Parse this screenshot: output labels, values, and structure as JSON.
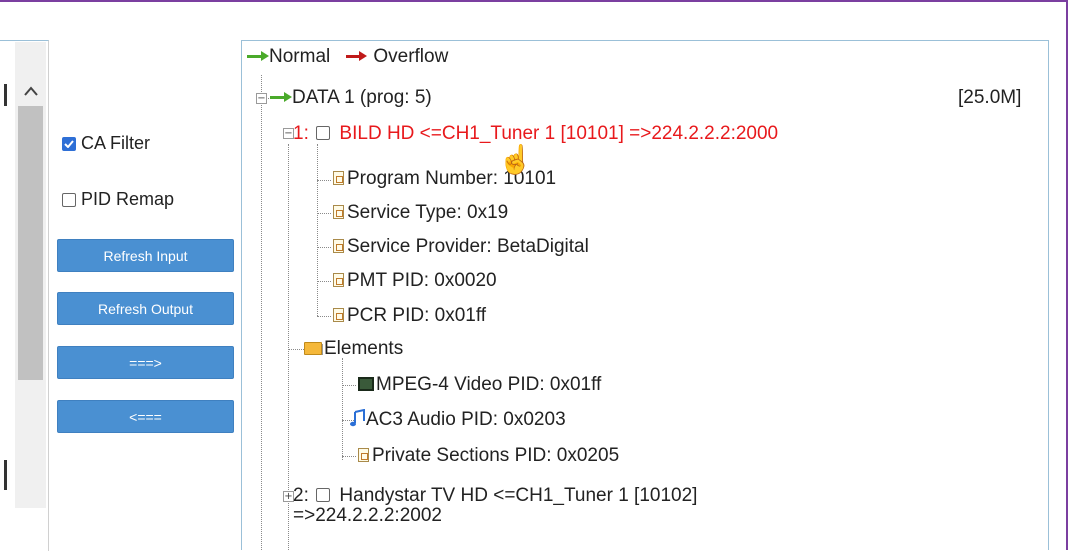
{
  "options": {
    "ca_filter": "CA Filter",
    "pid_remap": "PID Remap"
  },
  "buttons": {
    "refresh_input": "Refresh Input",
    "refresh_output": "Refresh Output",
    "forward": "===>",
    "back": "<==="
  },
  "legend": {
    "normal": "Normal",
    "overflow": "Overflow"
  },
  "tree": {
    "data_node": "DATA 1 (prog: 5)",
    "data_rate": "[25.0M]",
    "program1": {
      "label": "1:",
      "text": "BILD HD <=CH1_Tuner 1 [10101] =>224.2.2.2:2000",
      "program_number": "Program Number: 10101",
      "service_type": "Service Type: 0x19",
      "service_provider": "Service Provider: BetaDigital",
      "pmt_pid": "PMT PID: 0x0020",
      "pcr_pid": "PCR PID: 0x01ff",
      "elements": "Elements",
      "video": "MPEG-4 Video PID: 0x01ff",
      "audio": "AC3 Audio PID: 0x0203",
      "private": "Private Sections PID: 0x0205"
    },
    "program2": {
      "label": "2:",
      "text_line1": "Handystar TV HD <=CH1_Tuner 1 [10102]",
      "text_line2": "=>224.2.2.2:2002"
    }
  },
  "colors": {
    "button_bg": "#4a90d2",
    "error_red": "#e8191c",
    "frame_purple": "#7b3fa0"
  }
}
